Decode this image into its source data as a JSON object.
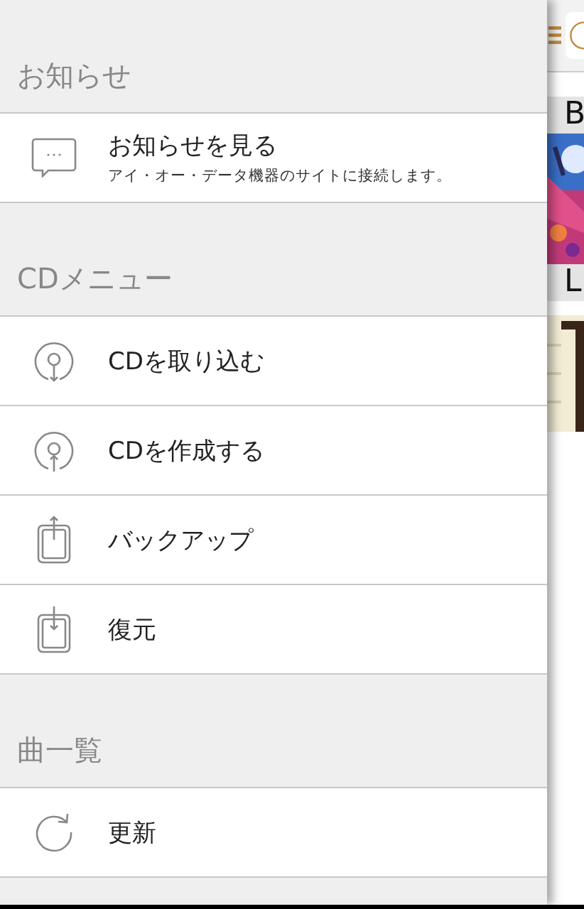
{
  "drawer": {
    "sections": [
      {
        "title": "お知らせ",
        "items": [
          {
            "kind": "message",
            "label": "お知らせを見る",
            "sublabel": "アイ・オー・データ機器のサイトに接続します。"
          }
        ]
      },
      {
        "title": "CDメニュー",
        "items": [
          {
            "kind": "cd-import",
            "label": "CDを取り込む"
          },
          {
            "kind": "cd-burn",
            "label": "CDを作成する"
          },
          {
            "kind": "backup",
            "label": "バックアップ"
          },
          {
            "kind": "restore",
            "label": "復元"
          }
        ]
      },
      {
        "title": "曲一覧",
        "items": [
          {
            "kind": "refresh",
            "label": "更新"
          }
        ]
      }
    ]
  },
  "background_app": {
    "groups": [
      {
        "letter": "B"
      },
      {
        "letter": "L"
      }
    ]
  }
}
